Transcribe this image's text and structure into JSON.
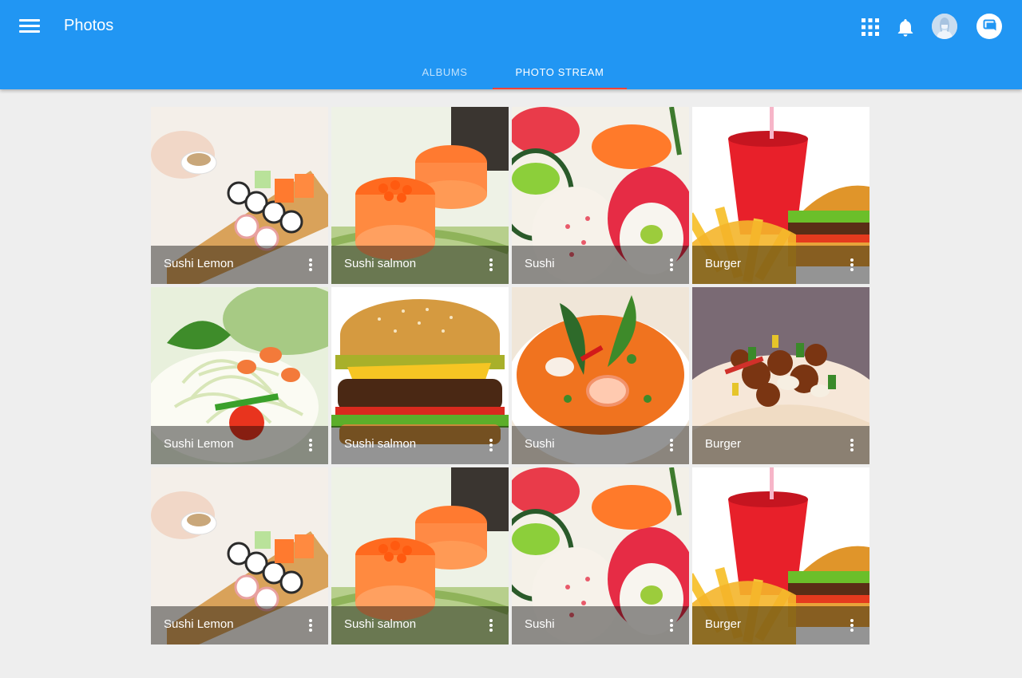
{
  "app": {
    "title": "Photos",
    "primary_color": "#2196f3",
    "accent_color": "#f44336"
  },
  "header": {
    "menu_icon": "hamburger-menu-icon",
    "actions": [
      {
        "name": "apps-icon"
      },
      {
        "name": "notifications-icon"
      },
      {
        "name": "avatar"
      },
      {
        "name": "chat-icon"
      }
    ]
  },
  "tabs": [
    {
      "label": "ALBUMS",
      "active": false
    },
    {
      "label": "PHOTO STREAM",
      "active": true
    }
  ],
  "photos": [
    {
      "title": "Sushi Lemon",
      "kind": "sushi-board"
    },
    {
      "title": "Sushi salmon",
      "kind": "salmon-roll"
    },
    {
      "title": "Sushi",
      "kind": "sushi-rolls"
    },
    {
      "title": "Burger",
      "kind": "burger-fries"
    },
    {
      "title": "Sushi Lemon",
      "kind": "papaya-salad"
    },
    {
      "title": "Sushi salmon",
      "kind": "burger"
    },
    {
      "title": "Sushi",
      "kind": "tom-yum"
    },
    {
      "title": "Burger",
      "kind": "stir-fry"
    },
    {
      "title": "Sushi Lemon",
      "kind": "sushi-board"
    },
    {
      "title": "Sushi salmon",
      "kind": "salmon-roll"
    },
    {
      "title": "Sushi",
      "kind": "sushi-rolls"
    },
    {
      "title": "Burger",
      "kind": "burger-fries"
    }
  ]
}
